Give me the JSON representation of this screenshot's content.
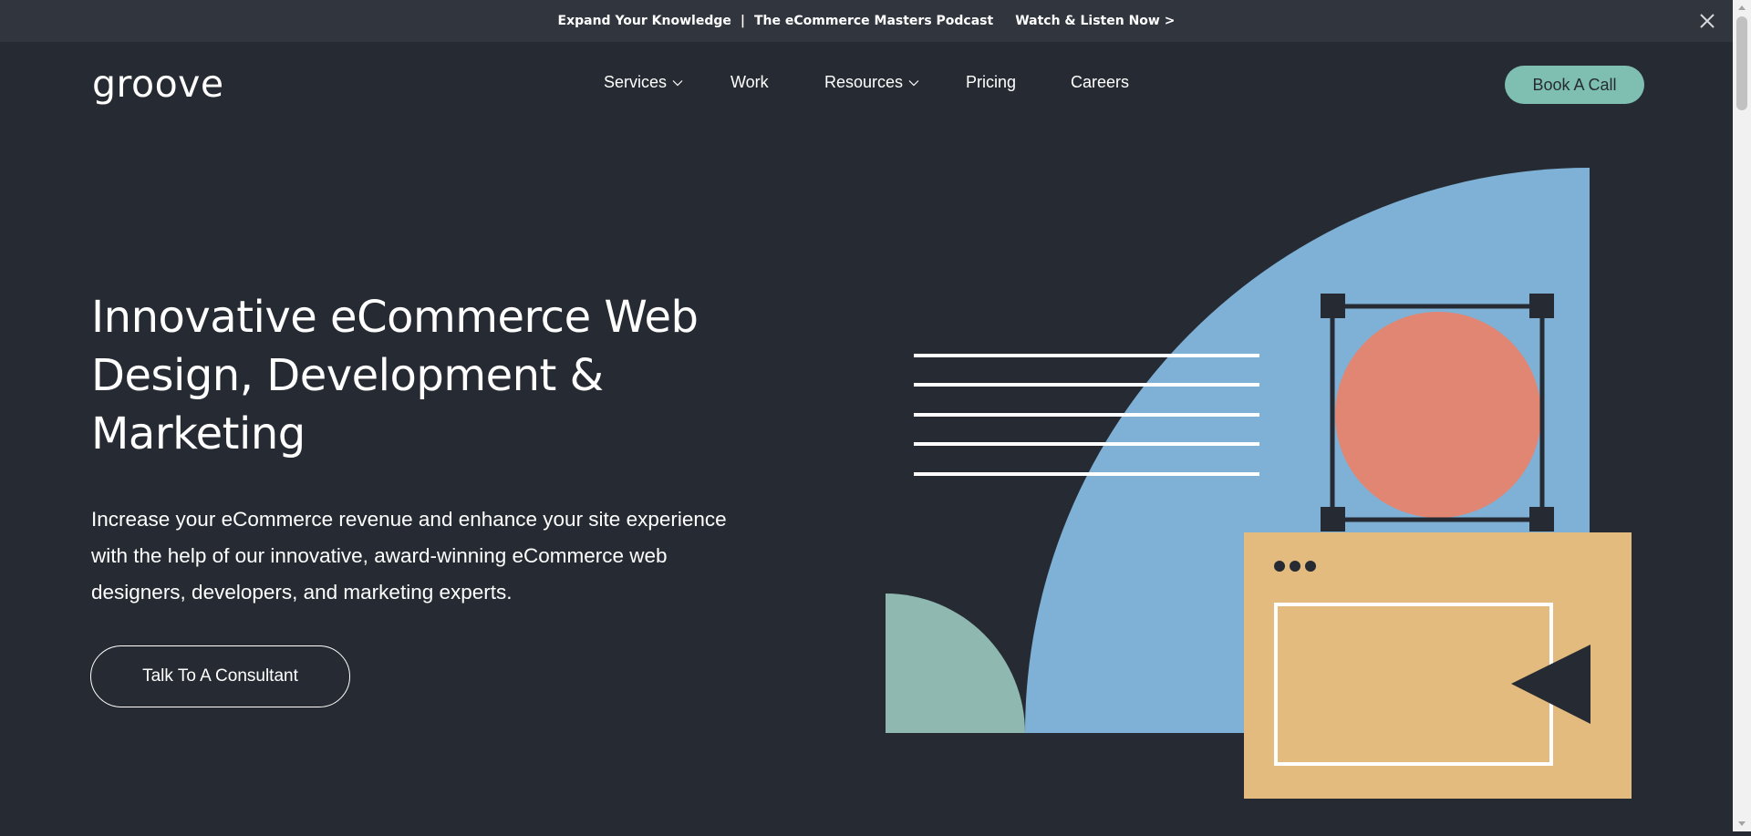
{
  "announcement": {
    "left": "Expand Your Knowledge",
    "separator": "|",
    "middle": "The eCommerce Masters Podcast",
    "cta": "Watch & Listen Now >",
    "close_icon": "close-icon"
  },
  "header": {
    "logo": "groove",
    "nav": [
      {
        "label": "Services",
        "has_dropdown": true
      },
      {
        "label": "Work",
        "has_dropdown": false
      },
      {
        "label": "Resources",
        "has_dropdown": true
      },
      {
        "label": "Pricing",
        "has_dropdown": false
      },
      {
        "label": "Careers",
        "has_dropdown": false
      }
    ],
    "book_label": "Book A Call"
  },
  "hero": {
    "title": "Innovative eCommerce Web Design, Development & Marketing",
    "description": "Increase your eCommerce revenue and enhance your site experience with the help of our innovative, award-winning eCommerce web designers, developers, and marketing experts.",
    "cta_label": "Talk To A Consultant"
  },
  "colors": {
    "background": "#262b33",
    "announcement_bg": "#30353e",
    "accent_teal": "#7fbfb1",
    "blue": "#7fb1d6",
    "coral": "#e08673",
    "sand": "#e3bb7e",
    "sage": "#8fb8b1"
  }
}
